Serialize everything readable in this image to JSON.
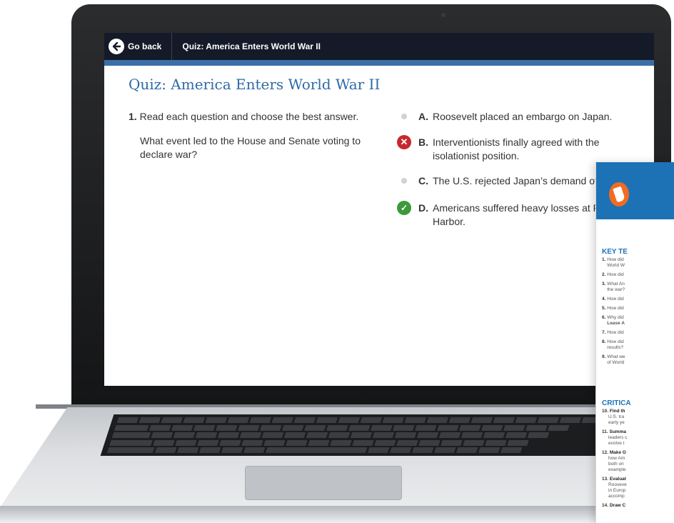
{
  "app_bar": {
    "back_label": "Go back",
    "title": "Quiz: America Enters World War II"
  },
  "quiz": {
    "heading": "Quiz: America Enters World War II",
    "question_number": "1.",
    "instruction": "Read each question and choose the best answer.",
    "question": "What event led to the House and Senate voting to declare war?",
    "answers": [
      {
        "letter": "A.",
        "text": "Roosevelt placed an embargo on Japan.",
        "state": "unselected"
      },
      {
        "letter": "B.",
        "text": "Interventionists finally agreed with the isolationist position.",
        "state": "incorrect"
      },
      {
        "letter": "C.",
        "text": "The U.S. rejected Japan’s demand of expa",
        "state": "unselected"
      },
      {
        "letter": "D.",
        "text": "Americans suffered heavy losses at Pearl Harbor.",
        "state": "correct"
      }
    ]
  },
  "book": {
    "key_terms_heading": "KEY TE",
    "key_items": [
      {
        "n": "1.",
        "lines": [
          "How did",
          "World W"
        ]
      },
      {
        "n": "2.",
        "lines": [
          "How did"
        ]
      },
      {
        "n": "3.",
        "lines": [
          "What An",
          "the war?"
        ]
      },
      {
        "n": "4.",
        "lines": [
          "How did"
        ]
      },
      {
        "n": "5.",
        "lines": [
          "How did"
        ]
      },
      {
        "n": "6.",
        "lines": [
          "Why did",
          "Lease A"
        ]
      },
      {
        "n": "7.",
        "lines": [
          "How did"
        ]
      },
      {
        "n": "8.",
        "lines": [
          "How did",
          "results?"
        ]
      },
      {
        "n": "9.",
        "lines": [
          "What we",
          "of World"
        ]
      }
    ],
    "critical_heading": "CRITICA",
    "critical_items": [
      {
        "n": "10.",
        "lead": "Find th",
        "lines": [
          "U.S. tra",
          "early ye"
        ]
      },
      {
        "n": "11.",
        "lead": "Summa",
        "lines": [
          "leaders c",
          "evolve t"
        ]
      },
      {
        "n": "12.",
        "lead": "Make G",
        "lines": [
          "how Am",
          "both on",
          "example"
        ]
      },
      {
        "n": "13.",
        "lead": "Evaluat",
        "lines": [
          "Rooseve",
          "in Europ",
          "accomp"
        ]
      },
      {
        "n": "14.",
        "lead": "Draw C",
        "lines": []
      }
    ]
  },
  "colors": {
    "app_bar": "#141a28",
    "accent": "#3b6fa8",
    "title": "#2f6aa5",
    "incorrect": "#c7282d",
    "correct": "#3c9a3a",
    "book_header": "#1d72b6",
    "badge": "#f26b22"
  },
  "icons": {
    "back": "arrow-left-circle-icon",
    "incorrect": "x-circle-icon",
    "correct": "checkmark-circle-icon",
    "badge": "california-state-icon"
  }
}
